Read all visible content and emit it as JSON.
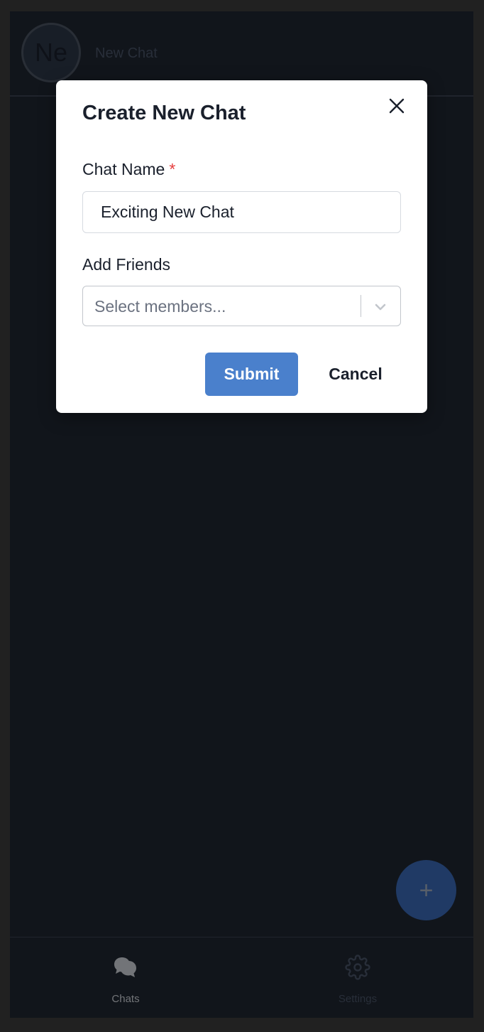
{
  "header": {
    "avatar_initials": "Ne",
    "title": "New Chat"
  },
  "fab": {
    "label": "+"
  },
  "bottom_nav": {
    "items": [
      {
        "label": "Chats",
        "icon": "chat-bubbles-icon",
        "active": true
      },
      {
        "label": "Settings",
        "icon": "gear-icon",
        "active": false
      }
    ]
  },
  "modal": {
    "title": "Create New Chat",
    "chat_name_label": "Chat Name",
    "required_marker": "*",
    "chat_name_value": "Exciting New Chat",
    "add_friends_label": "Add Friends",
    "members_placeholder": "Select members...",
    "submit_label": "Submit",
    "cancel_label": "Cancel"
  },
  "colors": {
    "background": "#1f2732",
    "primary": "#4a80cc",
    "required": "#e53e3e",
    "modal_bg": "#ffffff"
  }
}
